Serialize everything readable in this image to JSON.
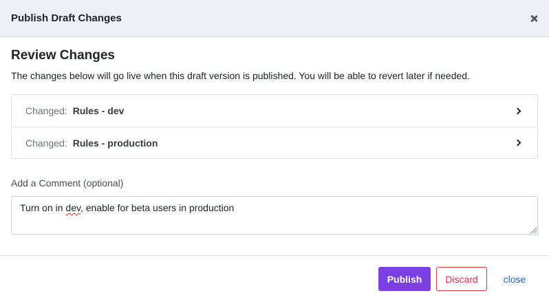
{
  "header": {
    "title": "Publish Draft Changes",
    "close_icon": "close-icon"
  },
  "body": {
    "section_title": "Review Changes",
    "description": "The changes below will go live when this draft version is published. You will be able to revert later if needed.",
    "changes": [
      {
        "prefix": "Changed:",
        "name": "Rules - dev"
      },
      {
        "prefix": "Changed:",
        "name": "Rules - production"
      }
    ],
    "comment": {
      "label": "Add a Comment (optional)",
      "value_before": "Turn on in ",
      "value_misspelled": "dev",
      "value_after": ", enable for beta users in production"
    }
  },
  "footer": {
    "publish_label": "Publish",
    "discard_label": "Discard",
    "close_label": "close"
  },
  "colors": {
    "header_bg": "#eef0f5",
    "publish": "#7b3fe4",
    "discard": "#dc3545",
    "link": "#2567d8"
  }
}
